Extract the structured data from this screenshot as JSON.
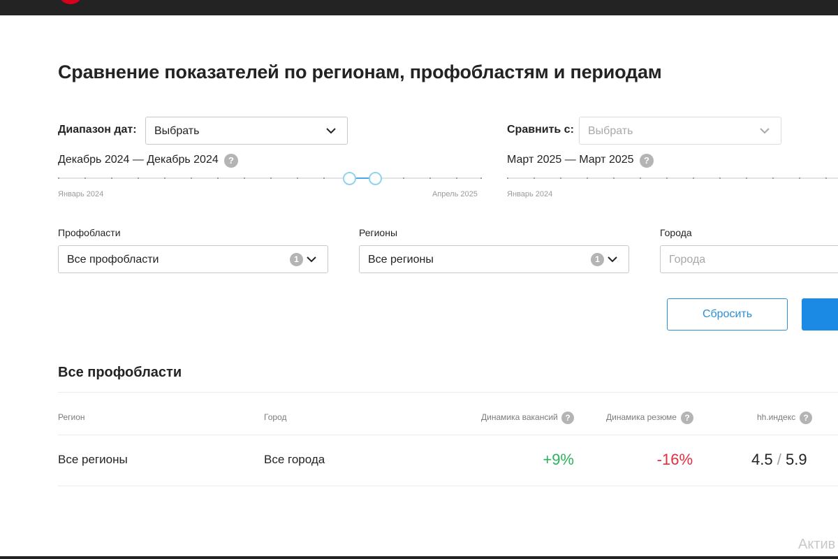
{
  "page": {
    "title": "Сравнение показателей по регионам, профобластям и периодам"
  },
  "date_range": {
    "label": "Диапазон дат:",
    "select_value": "Выбрать",
    "range_text": "Декабрь 2024 — Декабрь 2024",
    "slider_start_caption": "Январь 2024",
    "slider_end_caption": "Апрель 2025"
  },
  "compare": {
    "label": "Сравнить с:",
    "select_placeholder": "Выбрать",
    "range_text": "Март 2025 — Март 2025",
    "slider_start_caption": "Январь 2024"
  },
  "filters": {
    "profareas": {
      "label": "Профобласти",
      "value": "Все профобласти",
      "count": "1"
    },
    "regions": {
      "label": "Регионы",
      "value": "Все регионы",
      "count": "1"
    },
    "cities": {
      "label": "Города",
      "placeholder": "Города"
    }
  },
  "buttons": {
    "reset": "Сбросить"
  },
  "results": {
    "section_title": "Все профобласти",
    "columns": {
      "region": "Регион",
      "city": "Город",
      "vacancies": "Динамика вакансий",
      "resumes": "Динамика резюме",
      "hh_index": "hh.индекс"
    },
    "rows": [
      {
        "region": "Все регионы",
        "city": "Все города",
        "vacancies": "+9%",
        "resumes": "-16%",
        "hh_index_a": "4.5",
        "hh_index_sep": "/",
        "hh_index_b": "5.9"
      }
    ]
  },
  "help_icon_glyph": "?",
  "watermark": "Актив",
  "colors": {
    "accent": "#1a8ae5",
    "positive": "#2bb35b",
    "negative": "#e52b3e",
    "topbar": "#232323",
    "brand": "#d6001c"
  }
}
